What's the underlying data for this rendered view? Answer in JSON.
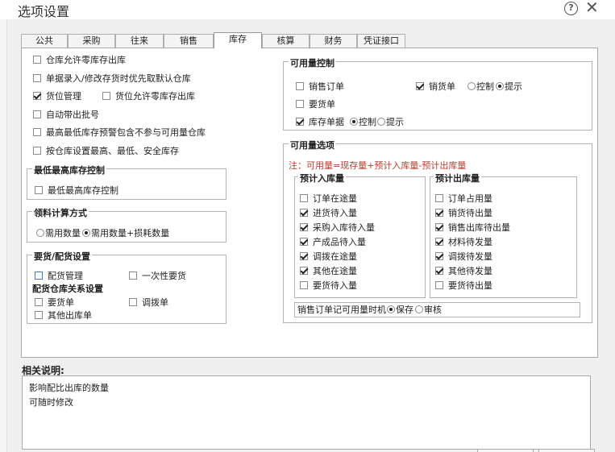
{
  "window": {
    "title": "选项设置"
  },
  "tabs": [
    "公共",
    "采购",
    "往来",
    "销售",
    "库存",
    "核算",
    "财务",
    "凭证接口"
  ],
  "active_tab": "库存",
  "left_options": [
    "仓库允许零库存出库",
    "单据录入/修改存货时优先取默认仓库",
    "货位管理",
    "货位允许零库存出库",
    "自动带出批号",
    "最高最低库存预警包含不参与可用量仓库",
    "按仓库设置最高、最低、安全库存"
  ],
  "max_min_group": {
    "title": "最低最高库存控制",
    "option": "最低最高库存控制"
  },
  "material_calc": {
    "title": "领料计算方式",
    "option_a": "需用数量",
    "option_b": "需用数量+损耗数量"
  },
  "supply_group": {
    "title": "要货/配货设置",
    "option_a": "配货管理",
    "option_b": "一次性要货",
    "sub_title": "配货仓库关系设置",
    "option_c": "要货单",
    "option_d": "调拨单",
    "option_e": "其他出库单"
  },
  "avail_control": {
    "title": "可用量控制",
    "sales_order": "销售订单",
    "sales_invoice": "销货单",
    "control": "控制",
    "prompt": "提示",
    "requisition": "要货单",
    "stock_doc": "库存单据"
  },
  "avail_options": {
    "title": "可用量选项",
    "note": "注：可用量=现存量+预计入库量-预计出库量",
    "inbound_title": "预计入库量",
    "inbound_items": [
      "订单在途量",
      "进货待入量",
      "采购入库待入量",
      "产成品待入量",
      "调拨在途量",
      "其他在途量",
      "要货待入量"
    ],
    "outbound_title": "预计出库量",
    "outbound_items": [
      "订单占用量",
      "销货待出量",
      "销售出库待出量",
      "材料待发量",
      "调拨待发量",
      "其他待发量",
      "要货待出量"
    ],
    "timing_label": "销售订单记可用量时机",
    "timing_save": "保存",
    "timing_audit": "审核"
  },
  "related": {
    "label": "相关说明:",
    "line1": "影响配比出库的数量",
    "line2": "可随时修改"
  }
}
